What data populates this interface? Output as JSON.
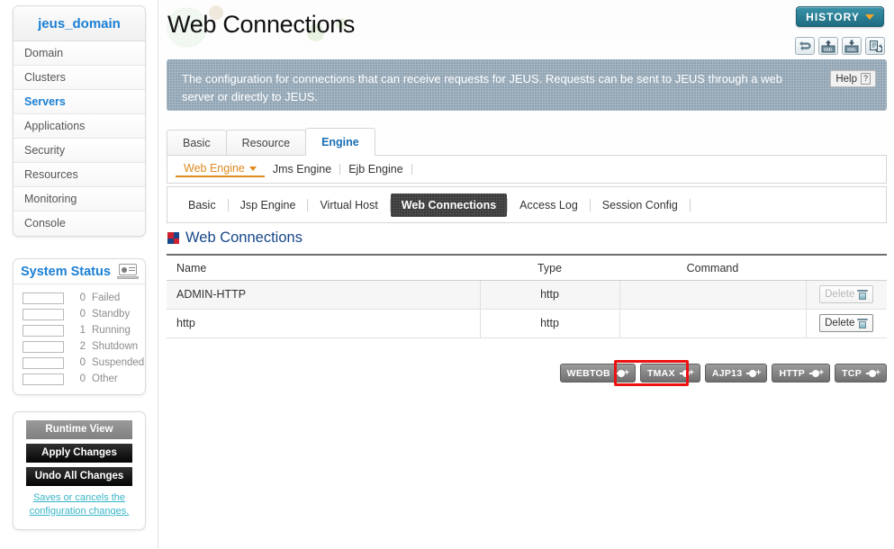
{
  "sidebar": {
    "domain_title": "jeus_domain",
    "nav_items": [
      {
        "label": "Domain",
        "active": false
      },
      {
        "label": "Clusters",
        "active": false
      },
      {
        "label": "Servers",
        "active": true
      },
      {
        "label": "Applications",
        "active": false
      },
      {
        "label": "Security",
        "active": false
      },
      {
        "label": "Resources",
        "active": false
      },
      {
        "label": "Monitoring",
        "active": false
      },
      {
        "label": "Console",
        "active": false
      }
    ],
    "system_status": {
      "title": "System Status",
      "icon": "laptop-icon",
      "rows": [
        {
          "count": "0",
          "label": "Failed",
          "fill": "none"
        },
        {
          "count": "0",
          "label": "Standby",
          "fill": "none"
        },
        {
          "count": "1",
          "label": "Running",
          "fill": "green"
        },
        {
          "count": "2",
          "label": "Shutdown",
          "fill": "red"
        },
        {
          "count": "0",
          "label": "Suspended",
          "fill": "none"
        },
        {
          "count": "0",
          "label": "Other",
          "fill": "none"
        }
      ]
    },
    "actions": {
      "runtime_view": "Runtime View",
      "apply_changes": "Apply Changes",
      "undo_all_changes": "Undo All Changes",
      "hint": "Saves or cancels the configuration changes",
      "hint_period": "."
    }
  },
  "header": {
    "page_title": "Web Connections",
    "history_label": "HISTORY",
    "toolbar_icons": [
      "refresh-icon",
      "xml-upload-icon",
      "xml-download-icon",
      "restore-icon"
    ]
  },
  "banner": {
    "text": "The configuration for connections that can receive requests for JEUS. Requests can be sent to JEUS through a web server or directly to JEUS.",
    "help_label": "Help",
    "help_mark": "?"
  },
  "tabs_primary": [
    {
      "label": "Basic",
      "active": false
    },
    {
      "label": "Resource",
      "active": false
    },
    {
      "label": "Engine",
      "active": true
    }
  ],
  "engine_row": [
    {
      "label": "Web Engine",
      "active": true
    },
    {
      "label": "Jms Engine",
      "active": false
    },
    {
      "label": "Ejb Engine",
      "active": false
    }
  ],
  "tabs_secondary": [
    {
      "label": "Basic",
      "active": false
    },
    {
      "label": "Jsp Engine",
      "active": false
    },
    {
      "label": "Virtual Host",
      "active": false
    },
    {
      "label": "Web Connections",
      "active": true
    },
    {
      "label": "Access Log",
      "active": false
    },
    {
      "label": "Session Config",
      "active": false
    }
  ],
  "section": {
    "title": "Web Connections",
    "icon": "pinwheel-icon"
  },
  "table": {
    "columns": [
      "Name",
      "Type",
      "Command"
    ],
    "rows": [
      {
        "name": "ADMIN-HTTP",
        "type": "http",
        "command": "",
        "action": "Delete",
        "action_enabled": false
      },
      {
        "name": "http",
        "type": "http",
        "command": "",
        "action": "Delete",
        "action_enabled": true
      }
    ]
  },
  "connector_buttons": [
    {
      "label": "WEBTOB",
      "highlighted": true
    },
    {
      "label": "TMAX",
      "highlighted": false
    },
    {
      "label": "AJP13",
      "highlighted": false
    },
    {
      "label": "HTTP",
      "highlighted": false
    },
    {
      "label": "TCP",
      "highlighted": false
    }
  ],
  "colors": {
    "accent_blue": "#1a7fd4",
    "section_blue": "#17478a",
    "engine_orange": "#e08a1e",
    "history_teal": "#2b7f95",
    "banner_slate": "#8fa3b3",
    "highlight_red": "#ee1111",
    "status_green": "#8fcf8a",
    "status_red": "#d98b8b"
  }
}
